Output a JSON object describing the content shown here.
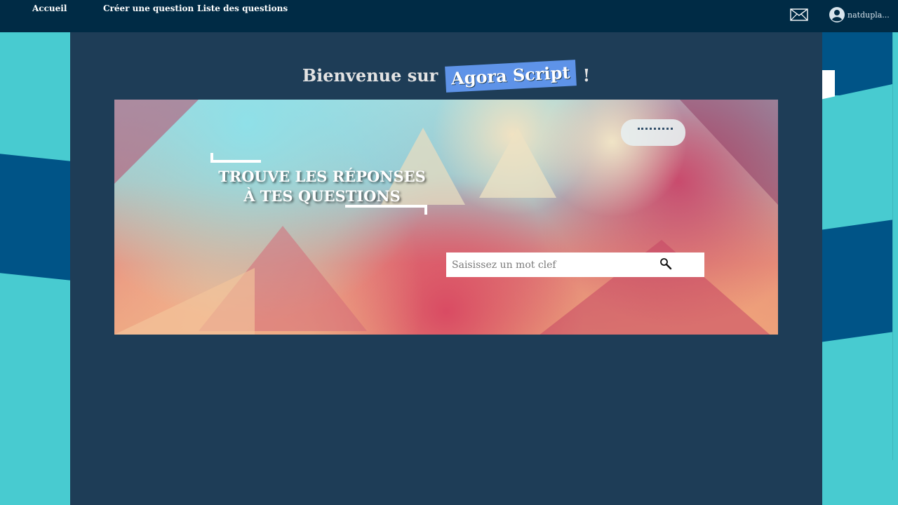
{
  "nav": {
    "home": "Accueil",
    "create": "Créer une question",
    "list": "Liste des questions"
  },
  "header_right": {
    "mail_icon": "envelope-icon",
    "user_icon": "user-circle-icon",
    "username": "natdupla..."
  },
  "welcome": {
    "prefix": "Bienvenue sur",
    "brand": "Agora Script",
    "suffix": "!"
  },
  "hero": {
    "headline_line1": "TROUVE LES RÉPONSES",
    "headline_line2": "À TES QUESTIONS"
  },
  "search": {
    "placeholder": "Saisissez un mot clef",
    "value": "",
    "icon": "search-icon"
  },
  "colors": {
    "topbar": "#002b45",
    "panel": "#1e3d57",
    "brand_badge": "#5e93e8",
    "background_teal": "#48cbd0",
    "background_blue": "#005487"
  }
}
